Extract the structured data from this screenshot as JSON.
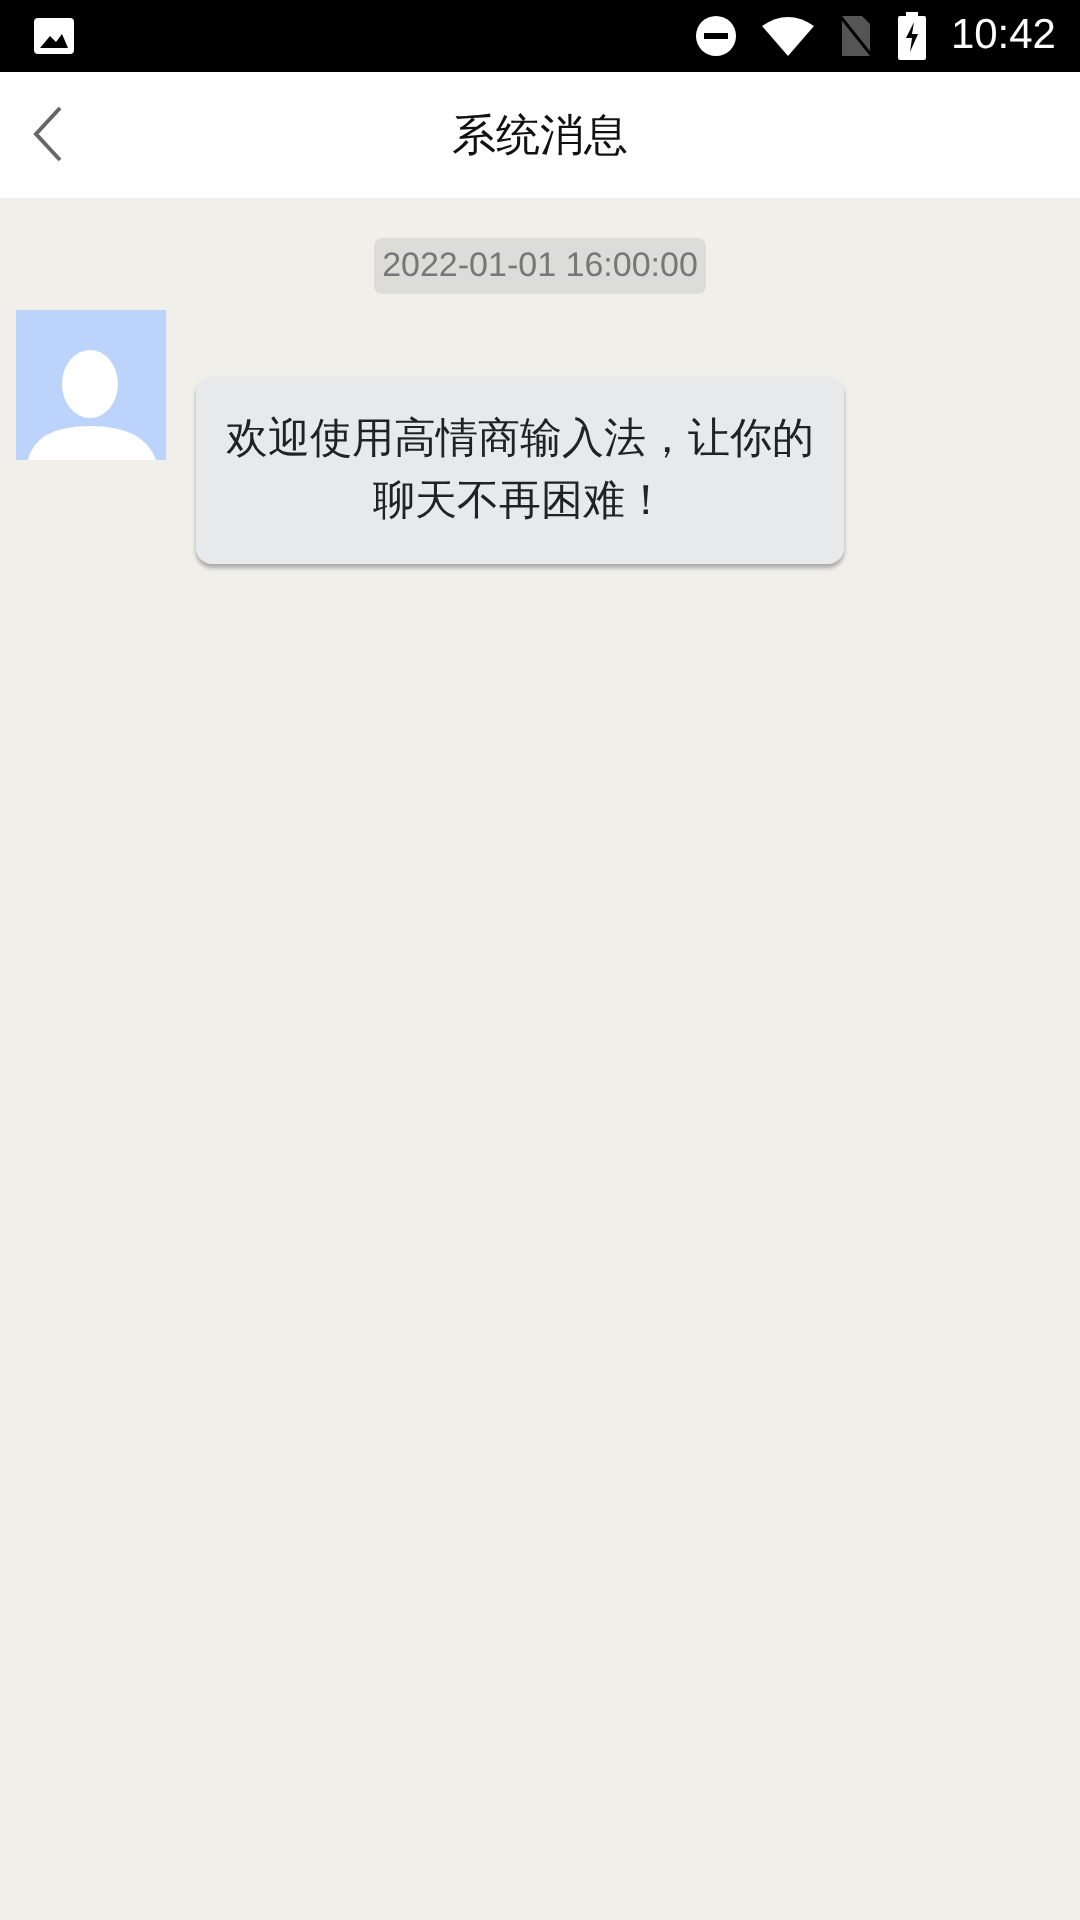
{
  "status_bar": {
    "time": "10:42"
  },
  "header": {
    "title": "系统消息"
  },
  "messages": [
    {
      "timestamp": "2022-01-01 16:00:00",
      "text": "欢迎使用高情商输入法，让你的聊天不再困难！"
    }
  ]
}
